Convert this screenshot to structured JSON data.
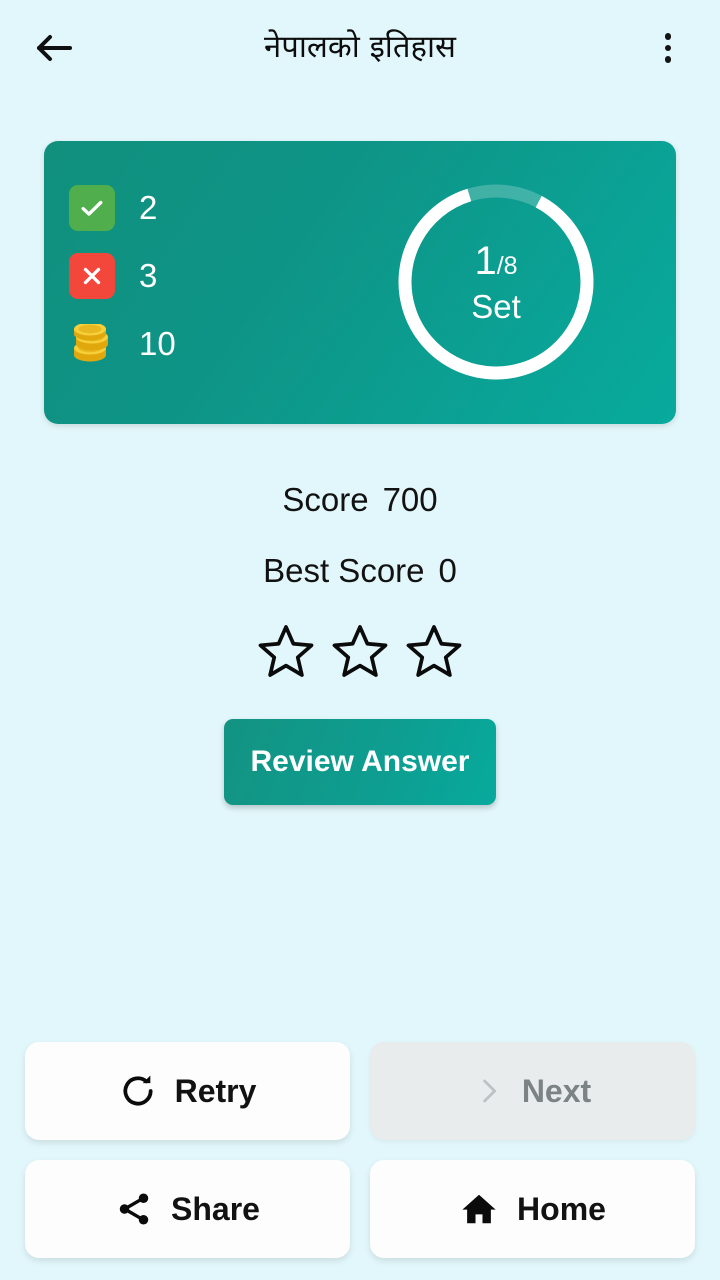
{
  "appbar": {
    "title": "नेपालको इतिहास",
    "back_icon": "arrow-left-icon",
    "menu_icon": "overflow-menu-icon"
  },
  "summary_card": {
    "stats": [
      {
        "icon": "check-icon",
        "label": "correct-count",
        "value": "2"
      },
      {
        "icon": "cross-icon",
        "label": "wrong-count",
        "value": "3"
      },
      {
        "icon": "coins-icon",
        "label": "coins-count",
        "value": "10",
        "glyph": "🪙"
      }
    ],
    "progress": {
      "current": "1",
      "denominator": "/8",
      "unit": "Set",
      "percent_complete": 87.5
    },
    "colors": {
      "card_start": "#11907e",
      "card_end": "#07aa9d",
      "correct_badge": "#50ae4c",
      "wrong_badge": "#f4473c"
    }
  },
  "results": {
    "score_label": "Score",
    "score_value": "700",
    "best_score_label": "Best Score",
    "best_score_value": "0",
    "stars_total": 3,
    "stars_earned": 0
  },
  "review": {
    "label": "Review Answer"
  },
  "actions": [
    {
      "key": "retry",
      "label": "Retry",
      "icon": "refresh-icon",
      "disabled": false
    },
    {
      "key": "next",
      "label": "Next",
      "icon": "chevron-right-icon",
      "disabled": true
    },
    {
      "key": "share",
      "label": "Share",
      "icon": "share-nodes-icon",
      "disabled": false
    },
    {
      "key": "home",
      "label": "Home",
      "icon": "home-icon",
      "disabled": false
    }
  ],
  "theme": {
    "background": "#e2f7fb",
    "accent": "#0d9e91",
    "text": "#121212"
  }
}
